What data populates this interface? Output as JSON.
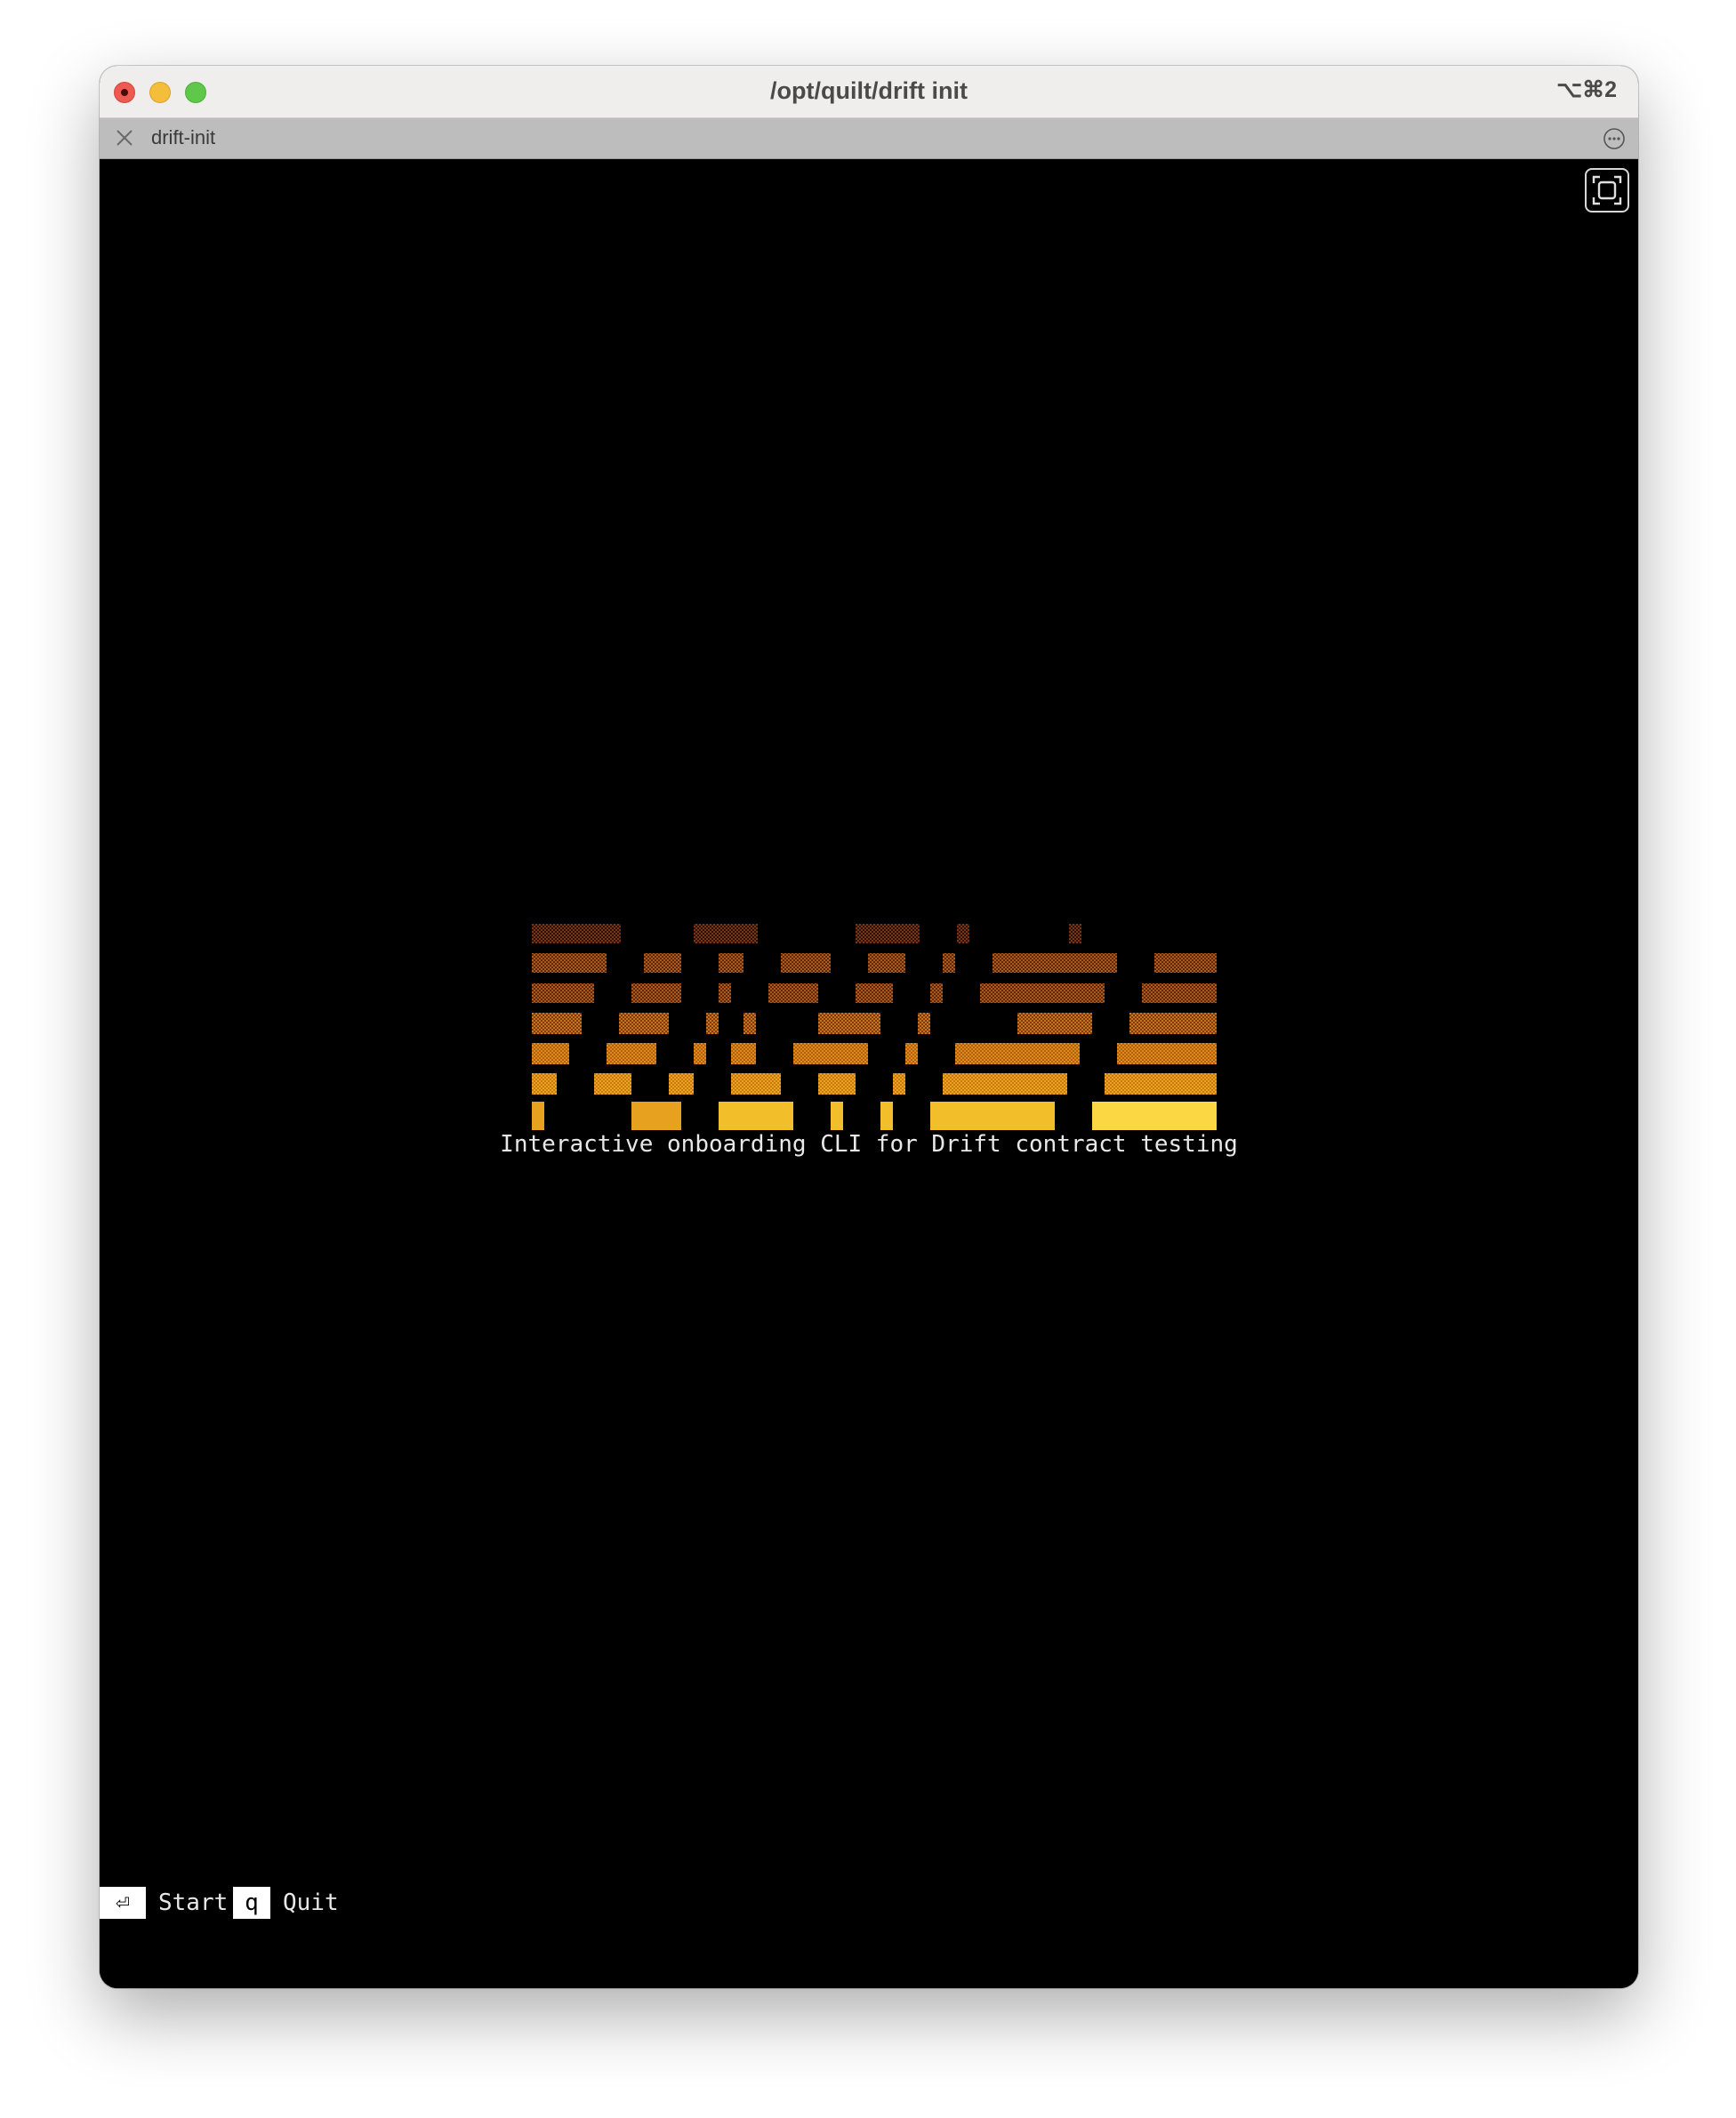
{
  "window": {
    "title": "/opt/quilt/drift init",
    "shortcut": "⌥⌘2"
  },
  "tab": {
    "label": "drift-init"
  },
  "terminal": {
    "tagline": "Interactive onboarding CLI for Drift contract testing",
    "footer": [
      {
        "key": "⏎",
        "label": "Start"
      },
      {
        "key": "q",
        "label": "Quit"
      }
    ],
    "logo_colors": [
      "#6b2e10",
      "#a04a12",
      "#c56a14",
      "#d98318",
      "#e8a11f",
      "#f2be2a",
      "#fbd843"
    ]
  }
}
